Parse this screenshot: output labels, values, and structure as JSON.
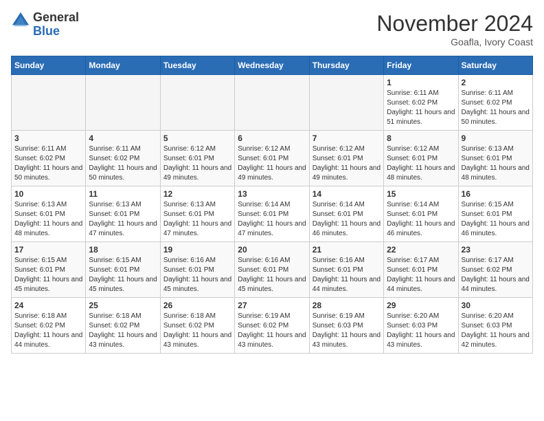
{
  "header": {
    "logo_general": "General",
    "logo_blue": "Blue",
    "month_title": "November 2024",
    "location": "Goafla, Ivory Coast"
  },
  "weekdays": [
    "Sunday",
    "Monday",
    "Tuesday",
    "Wednesday",
    "Thursday",
    "Friday",
    "Saturday"
  ],
  "weeks": [
    [
      {
        "day": "",
        "info": ""
      },
      {
        "day": "",
        "info": ""
      },
      {
        "day": "",
        "info": ""
      },
      {
        "day": "",
        "info": ""
      },
      {
        "day": "",
        "info": ""
      },
      {
        "day": "1",
        "info": "Sunrise: 6:11 AM\nSunset: 6:02 PM\nDaylight: 11 hours and 51 minutes."
      },
      {
        "day": "2",
        "info": "Sunrise: 6:11 AM\nSunset: 6:02 PM\nDaylight: 11 hours and 50 minutes."
      }
    ],
    [
      {
        "day": "3",
        "info": "Sunrise: 6:11 AM\nSunset: 6:02 PM\nDaylight: 11 hours and 50 minutes."
      },
      {
        "day": "4",
        "info": "Sunrise: 6:11 AM\nSunset: 6:02 PM\nDaylight: 11 hours and 50 minutes."
      },
      {
        "day": "5",
        "info": "Sunrise: 6:12 AM\nSunset: 6:01 PM\nDaylight: 11 hours and 49 minutes."
      },
      {
        "day": "6",
        "info": "Sunrise: 6:12 AM\nSunset: 6:01 PM\nDaylight: 11 hours and 49 minutes."
      },
      {
        "day": "7",
        "info": "Sunrise: 6:12 AM\nSunset: 6:01 PM\nDaylight: 11 hours and 49 minutes."
      },
      {
        "day": "8",
        "info": "Sunrise: 6:12 AM\nSunset: 6:01 PM\nDaylight: 11 hours and 48 minutes."
      },
      {
        "day": "9",
        "info": "Sunrise: 6:13 AM\nSunset: 6:01 PM\nDaylight: 11 hours and 48 minutes."
      }
    ],
    [
      {
        "day": "10",
        "info": "Sunrise: 6:13 AM\nSunset: 6:01 PM\nDaylight: 11 hours and 48 minutes."
      },
      {
        "day": "11",
        "info": "Sunrise: 6:13 AM\nSunset: 6:01 PM\nDaylight: 11 hours and 47 minutes."
      },
      {
        "day": "12",
        "info": "Sunrise: 6:13 AM\nSunset: 6:01 PM\nDaylight: 11 hours and 47 minutes."
      },
      {
        "day": "13",
        "info": "Sunrise: 6:14 AM\nSunset: 6:01 PM\nDaylight: 11 hours and 47 minutes."
      },
      {
        "day": "14",
        "info": "Sunrise: 6:14 AM\nSunset: 6:01 PM\nDaylight: 11 hours and 46 minutes."
      },
      {
        "day": "15",
        "info": "Sunrise: 6:14 AM\nSunset: 6:01 PM\nDaylight: 11 hours and 46 minutes."
      },
      {
        "day": "16",
        "info": "Sunrise: 6:15 AM\nSunset: 6:01 PM\nDaylight: 11 hours and 46 minutes."
      }
    ],
    [
      {
        "day": "17",
        "info": "Sunrise: 6:15 AM\nSunset: 6:01 PM\nDaylight: 11 hours and 45 minutes."
      },
      {
        "day": "18",
        "info": "Sunrise: 6:15 AM\nSunset: 6:01 PM\nDaylight: 11 hours and 45 minutes."
      },
      {
        "day": "19",
        "info": "Sunrise: 6:16 AM\nSunset: 6:01 PM\nDaylight: 11 hours and 45 minutes."
      },
      {
        "day": "20",
        "info": "Sunrise: 6:16 AM\nSunset: 6:01 PM\nDaylight: 11 hours and 45 minutes."
      },
      {
        "day": "21",
        "info": "Sunrise: 6:16 AM\nSunset: 6:01 PM\nDaylight: 11 hours and 44 minutes."
      },
      {
        "day": "22",
        "info": "Sunrise: 6:17 AM\nSunset: 6:01 PM\nDaylight: 11 hours and 44 minutes."
      },
      {
        "day": "23",
        "info": "Sunrise: 6:17 AM\nSunset: 6:02 PM\nDaylight: 11 hours and 44 minutes."
      }
    ],
    [
      {
        "day": "24",
        "info": "Sunrise: 6:18 AM\nSunset: 6:02 PM\nDaylight: 11 hours and 44 minutes."
      },
      {
        "day": "25",
        "info": "Sunrise: 6:18 AM\nSunset: 6:02 PM\nDaylight: 11 hours and 43 minutes."
      },
      {
        "day": "26",
        "info": "Sunrise: 6:18 AM\nSunset: 6:02 PM\nDaylight: 11 hours and 43 minutes."
      },
      {
        "day": "27",
        "info": "Sunrise: 6:19 AM\nSunset: 6:02 PM\nDaylight: 11 hours and 43 minutes."
      },
      {
        "day": "28",
        "info": "Sunrise: 6:19 AM\nSunset: 6:03 PM\nDaylight: 11 hours and 43 minutes."
      },
      {
        "day": "29",
        "info": "Sunrise: 6:20 AM\nSunset: 6:03 PM\nDaylight: 11 hours and 43 minutes."
      },
      {
        "day": "30",
        "info": "Sunrise: 6:20 AM\nSunset: 6:03 PM\nDaylight: 11 hours and 42 minutes."
      }
    ]
  ]
}
